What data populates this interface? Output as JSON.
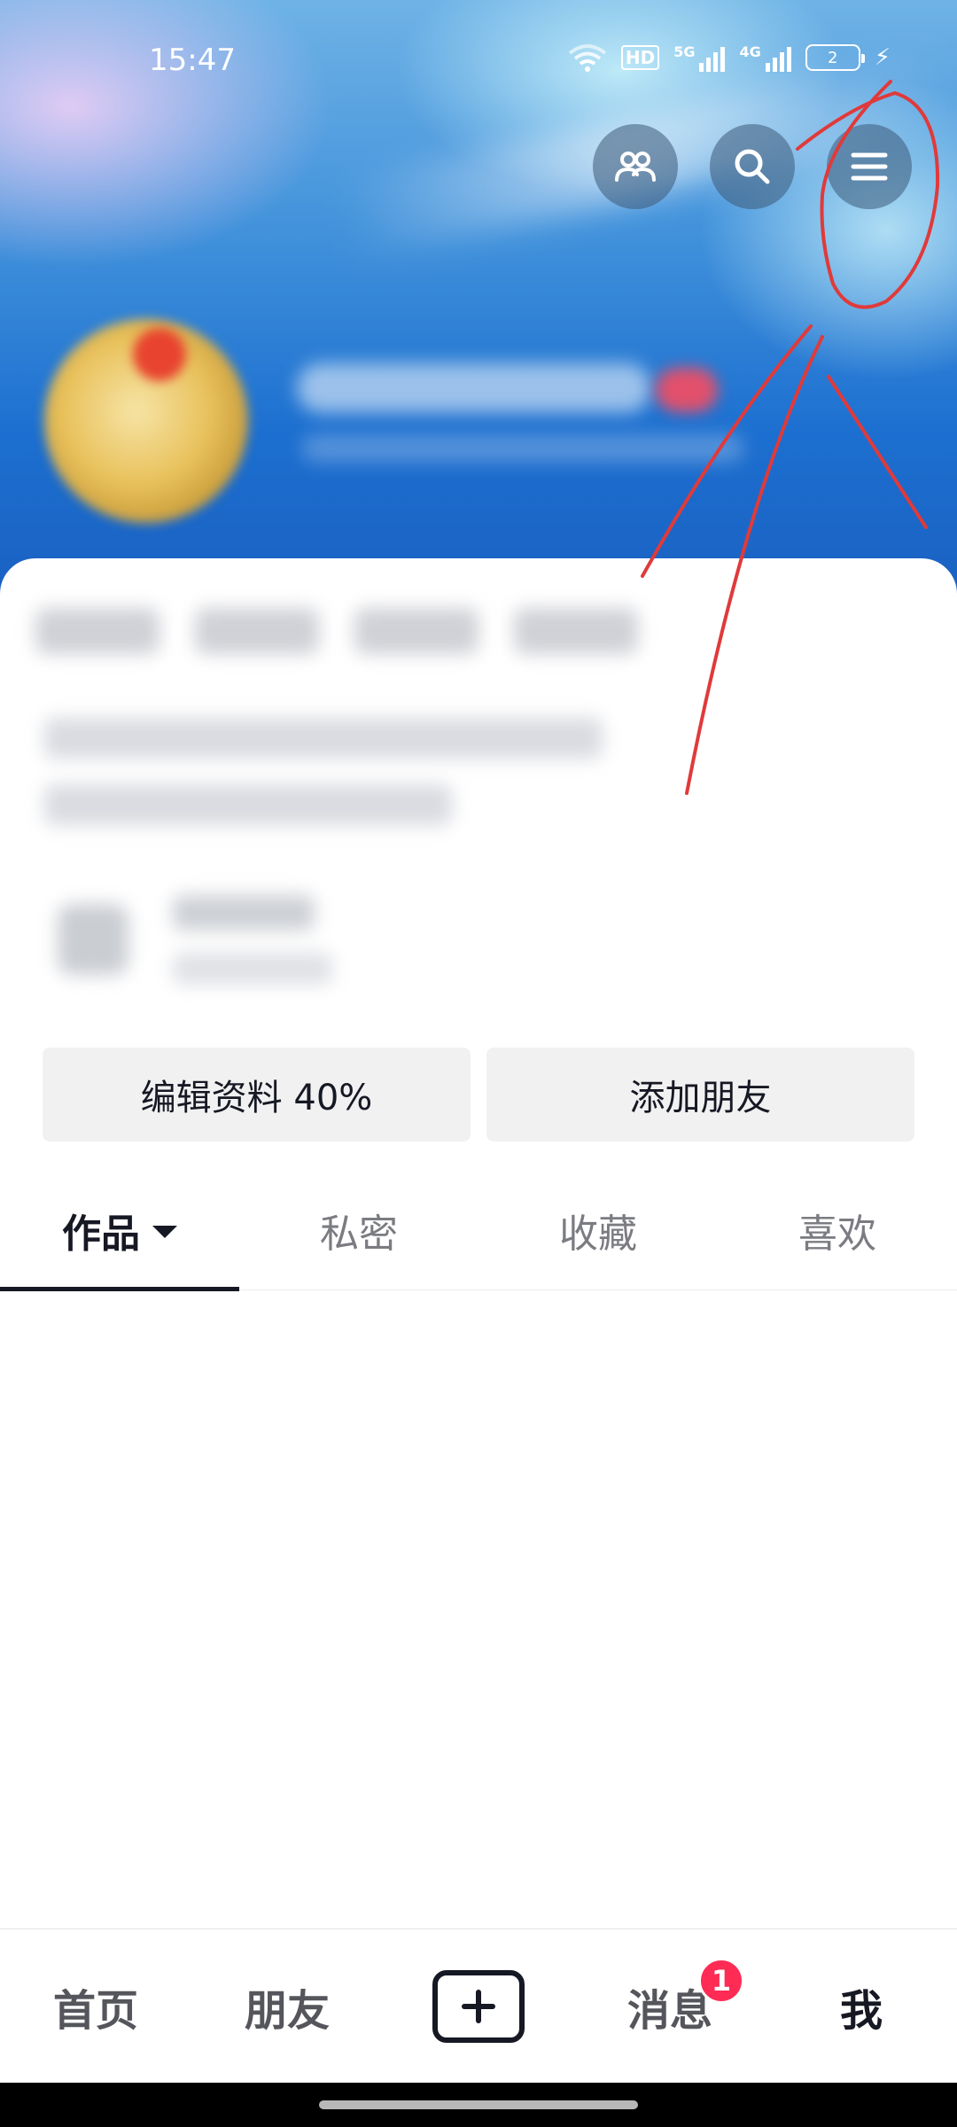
{
  "status_bar": {
    "time": "15:47",
    "hd_label": "HD",
    "signal1_label": "5G",
    "signal2_label": "4G",
    "battery_level": "2",
    "charging_icon": "bolt-icon"
  },
  "header": {
    "buttons": [
      {
        "icon": "friends-icon"
      },
      {
        "icon": "search-icon"
      },
      {
        "icon": "menu-icon"
      }
    ]
  },
  "profile": {
    "actions": {
      "edit_label": "编辑资料 40%",
      "add_friend_label": "添加朋友"
    }
  },
  "tabs": {
    "works": "作品",
    "private": "私密",
    "favorites": "收藏",
    "likes": "喜欢",
    "active": "作品"
  },
  "bottom_nav": {
    "home": "首页",
    "friends": "朋友",
    "messages": "消息",
    "messages_badge": "1",
    "me": "我",
    "active": "我"
  },
  "colors": {
    "badge": "#fe2c55",
    "annotation": "#e03a3a",
    "text_primary": "#161823",
    "button_bg": "#f1f1f2"
  }
}
